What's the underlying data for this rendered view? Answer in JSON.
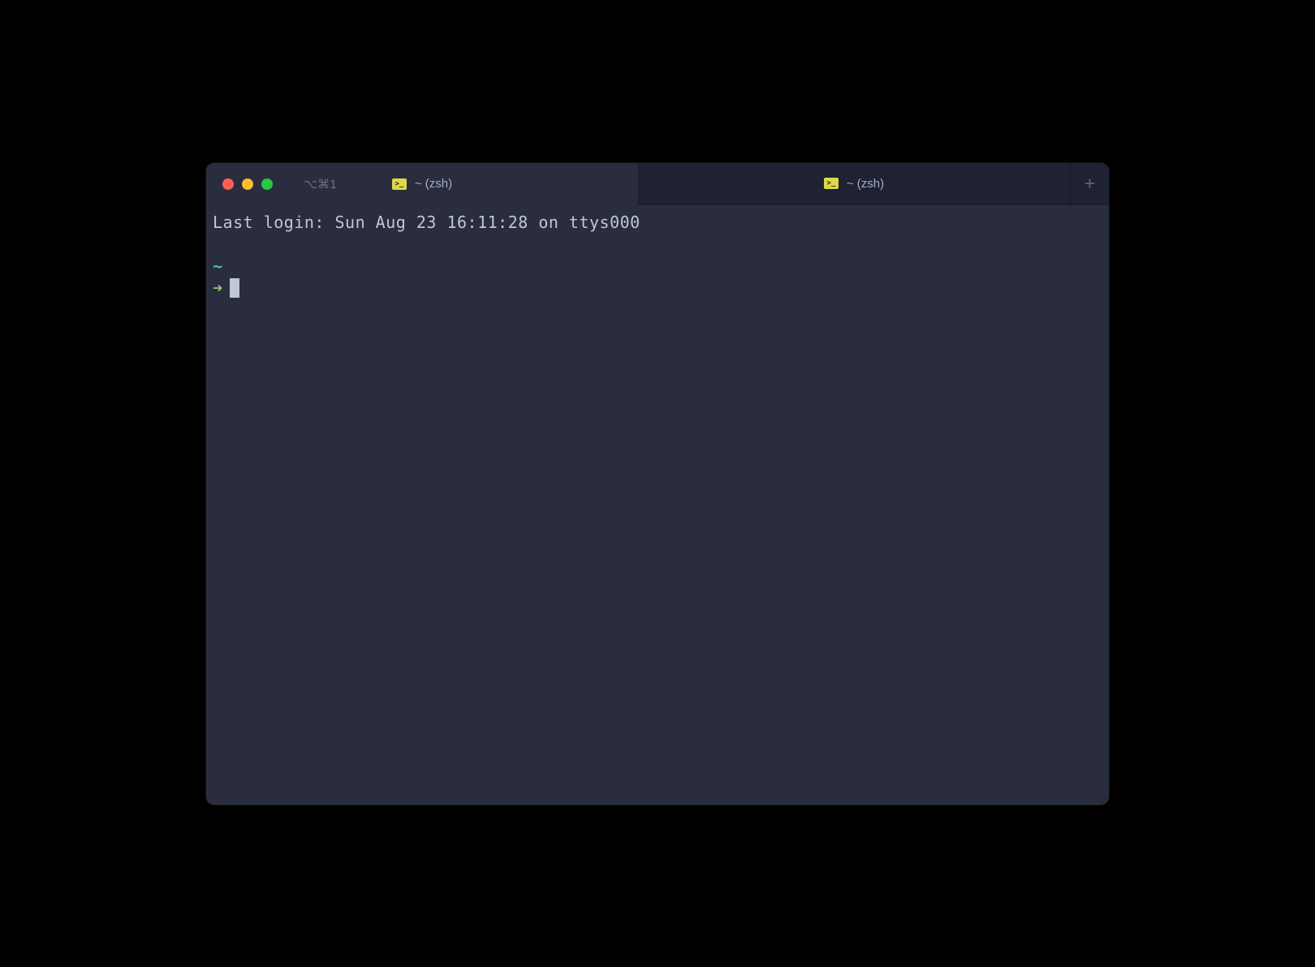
{
  "titlebar": {
    "shortcut": "⌥⌘1"
  },
  "tabs": [
    {
      "label": "~ (zsh)",
      "active": true
    },
    {
      "label": "~ (zsh)",
      "active": false
    }
  ],
  "terminal": {
    "last_login": "Last login: Sun Aug 23 16:11:28 on ttys000",
    "prompt_path": "~",
    "prompt_symbol": "➜"
  }
}
